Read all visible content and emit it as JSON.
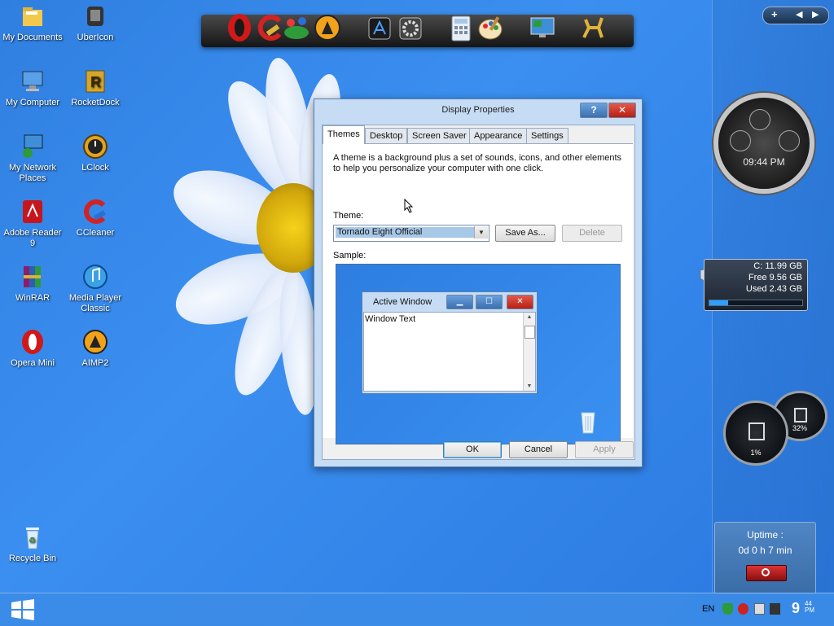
{
  "desktop": {
    "icons": [
      {
        "label": "My Documents",
        "icon": "folder-icon"
      },
      {
        "label": "UberIcon",
        "icon": "ubericon-icon"
      },
      {
        "label": "My Computer",
        "icon": "computer-icon"
      },
      {
        "label": "RocketDock",
        "icon": "rocketdock-icon"
      },
      {
        "label": "My Network Places",
        "icon": "network-icon"
      },
      {
        "label": "LClock",
        "icon": "lclock-icon"
      },
      {
        "label": "Adobe Reader 9",
        "icon": "adobe-reader-icon"
      },
      {
        "label": "CCleaner",
        "icon": "ccleaner-icon"
      },
      {
        "label": "WinRAR",
        "icon": "winrar-icon"
      },
      {
        "label": "Media Player Classic",
        "icon": "media-player-icon"
      },
      {
        "label": "Opera Mini",
        "icon": "opera-icon"
      },
      {
        "label": "AIMP2",
        "icon": "aimp-icon"
      },
      {
        "label": "Recycle Bin",
        "icon": "recycle-bin-icon"
      }
    ]
  },
  "dock": {
    "items": [
      "opera-icon",
      "ccleaner-icon",
      "network-icon",
      "aimp-icon",
      "app-store-icon",
      "settings-icon",
      "calculator-icon",
      "paint-icon",
      "display-icon",
      "deer-icon"
    ]
  },
  "sidebar": {
    "controls": {
      "add": "+",
      "prev": "◀",
      "next": "▶"
    },
    "clock": {
      "time": "09:44 PM"
    },
    "drive": {
      "label": "C:  11.99 GB",
      "free": "Free 9.56 GB",
      "used": "Used 2.43 GB",
      "used_fraction": 0.2
    },
    "cpu": {
      "value": "1%"
    },
    "memory": {
      "value": "32%"
    },
    "uptime": {
      "title": "Uptime :",
      "value": "0d 0 h 7 min"
    }
  },
  "taskbar": {
    "language": "EN",
    "clock_hour": "9",
    "clock_minute": "44",
    "clock_ampm": "PM"
  },
  "dialog": {
    "title": "Display Properties",
    "help_label": "?",
    "close_label": "✕",
    "tabs": [
      "Themes",
      "Desktop",
      "Screen Saver",
      "Appearance",
      "Settings"
    ],
    "active_tab": "Themes",
    "description": "A theme is a background plus a set of sounds, icons, and other elements to help you personalize your computer with one click.",
    "theme_label": "Theme:",
    "theme_value": "Tornado Eight Official",
    "save_as_label": "Save As...",
    "delete_label": "Delete",
    "sample_label": "Sample:",
    "preview": {
      "window_title": "Active Window",
      "window_text": "Window Text"
    },
    "ok_label": "OK",
    "cancel_label": "Cancel",
    "apply_label": "Apply"
  }
}
